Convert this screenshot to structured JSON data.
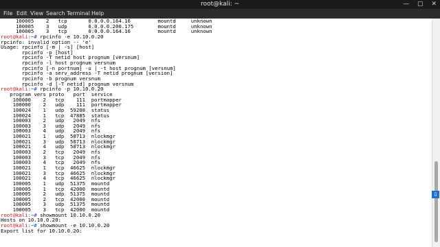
{
  "window": {
    "title": "root@kali: ~",
    "minimize_glyph": "—",
    "maximize_glyph": "▢",
    "close_glyph": "✕"
  },
  "menu": [
    "File",
    "Edit",
    "View",
    "Search",
    "Terminal",
    "Help"
  ],
  "prompt": {
    "user_host": "root@kali",
    "path": ":~# "
  },
  "terminal_lines": [
    {
      "text": "     100005    2   tcp       0.0.0.0.164.16         mountd     unknown"
    },
    {
      "text": "     100005    3   udp       0.0.0.0.200.175        mountd     unknown"
    },
    {
      "text": "     100005    3   tcp       0.0.0.0.164.16         mountd     unknown"
    },
    {
      "cmd": "rpcinfo -e 10.10.0.20"
    },
    {
      "text": "rpcinfo: invalid option -- 'e'"
    },
    {
      "text": "Usage: rpcinfo [-m | -s] [host]"
    },
    {
      "text": "       rpcinfo -p [host]"
    },
    {
      "text": "       rpcinfo -T netid host prognum [versnum]"
    },
    {
      "text": "       rpcinfo -l host prognum versnum"
    },
    {
      "text": "       rpcinfo [-n portnum] -u | -t host prognum [versnum]"
    },
    {
      "text": "       rpcinfo -a serv_address -T netid prognum [version]"
    },
    {
      "text": "       rpcinfo -b prognum versnum"
    },
    {
      "text": "       rpcinfo -d [-T netid] prognum versnum"
    },
    {
      "cmd": "rpcinfo -p 10.10.0.20"
    },
    {
      "text": "   program vers proto   port  service"
    },
    {
      "text": "    100000    2   tcp    111  portmapper"
    },
    {
      "text": "    100000    2   udp    111  portmapper"
    },
    {
      "text": "    100024    1   udp  59208  status"
    },
    {
      "text": "    100024    1   tcp  47885  status"
    },
    {
      "text": "    100003    2   udp   2049  nfs"
    },
    {
      "text": "    100003    3   udp   2049  nfs"
    },
    {
      "text": "    100003    4   udp   2049  nfs"
    },
    {
      "text": "    100021    1   udp  50713  nlockmgr"
    },
    {
      "text": "    100021    3   udp  50713  nlockmgr"
    },
    {
      "text": "    100021    4   udp  50713  nlockmgr"
    },
    {
      "text": "    100003    2   tcp   2049  nfs"
    },
    {
      "text": "    100003    3   tcp   2049  nfs"
    },
    {
      "text": "    100003    4   tcp   2049  nfs"
    },
    {
      "text": "    100021    1   tcp  46625  nlockmgr"
    },
    {
      "text": "    100021    3   tcp  46625  nlockmgr"
    },
    {
      "text": "    100021    4   tcp  46625  nlockmgr"
    },
    {
      "text": "    100005    1   udp  51375  mountd"
    },
    {
      "text": "    100005    1   tcp  42000  mountd"
    },
    {
      "text": "    100005    2   udp  51375  mountd"
    },
    {
      "text": "    100005    2   tcp  42000  mountd"
    },
    {
      "text": "    100005    3   udp  51375  mountd"
    },
    {
      "text": "    100005    3   tcp  42000  mountd"
    },
    {
      "cmd": "showmount 10.10.0.20"
    },
    {
      "text": "Hosts on 10.10.0.20:"
    },
    {
      "cmd": "showmount -e 10.10.0.20"
    },
    {
      "text": "Export list for 10.10.0.20:"
    }
  ],
  "colors": {
    "prompt_user": "#d4141e",
    "prompt_path": "#0b4fae",
    "scroll_button": "#1f6fd0"
  },
  "scroll_down_icon": "arrow-down",
  "scroll_down_glyph": "⇩"
}
